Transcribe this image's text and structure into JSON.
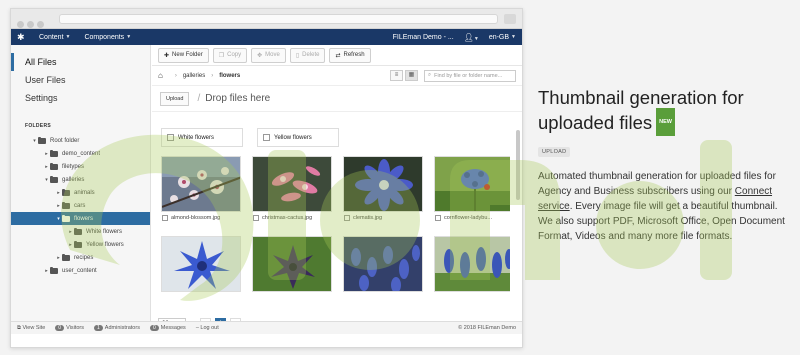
{
  "topbar": {
    "menu_content": "Content",
    "menu_components": "Components",
    "site_name": "FILEman Demo - ...",
    "language": "en-GB"
  },
  "sidebar": {
    "nav": [
      "All Files",
      "User Files",
      "Settings"
    ],
    "folders_label": "FOLDERS",
    "tree": [
      {
        "label": "Root folder",
        "depth": 0,
        "arrow": "▾"
      },
      {
        "label": "demo_content",
        "depth": 1,
        "arrow": "▸"
      },
      {
        "label": "filetypes",
        "depth": 1,
        "arrow": "▸"
      },
      {
        "label": "galleries",
        "depth": 1,
        "arrow": "▾"
      },
      {
        "label": "animals",
        "depth": 2,
        "arrow": "▸"
      },
      {
        "label": "cars",
        "depth": 2,
        "arrow": "▸"
      },
      {
        "label": "flowers",
        "depth": 2,
        "arrow": "▾",
        "selected": true
      },
      {
        "label": "White flowers",
        "depth": 3,
        "arrow": "▸"
      },
      {
        "label": "Yellow flowers",
        "depth": 3,
        "arrow": "▸"
      },
      {
        "label": "recipes",
        "depth": 2,
        "arrow": "▸"
      },
      {
        "label": "user_content",
        "depth": 1,
        "arrow": "▸"
      }
    ]
  },
  "toolbar": {
    "new_folder": "New Folder",
    "copy": "Copy",
    "move": "Move",
    "delete": "Delete",
    "refresh": "Refresh"
  },
  "path": {
    "galleries": "galleries",
    "flowers": "flowers",
    "search_placeholder": "Find by file or folder name..."
  },
  "dropzone": {
    "upload_btn": "Upload",
    "text": "Drop files here"
  },
  "folders": [
    "White flowers",
    "Yellow flowers"
  ],
  "files": [
    {
      "name": "almond-blossom.jpg",
      "icon": "flower-photo"
    },
    {
      "name": "christmas-cactus.jpg",
      "icon": "flower-photo"
    },
    {
      "name": "clematis.jpg",
      "icon": "flower-photo"
    },
    {
      "name": "cornflower-ladybu...",
      "icon": "flower-photo"
    }
  ],
  "pager": {
    "page_size": "20",
    "prev": "«",
    "current": "1",
    "next": "»"
  },
  "statusbar": {
    "view_site": "View Site",
    "visitors_count": "0",
    "visitors": "Visitors",
    "admins_count": "1",
    "admins": "Administrators",
    "messages_count": "0",
    "messages": "Messages",
    "logout": "Log out",
    "copyright": "© 2018 FILEman Demo"
  },
  "panel": {
    "title": "Thumbnail generation for uploaded files",
    "new_badge": "NEW",
    "tag": "UPLOAD",
    "text_1": "Automated thumbnail generation for uploaded files for Agency and Business subscribers using our ",
    "link": "Connect service",
    "text_2": ". Every image file will get a beautiful thumbnail. We also support PDF, Microsoft Office, Open Document Format, Videos and many more file formats."
  },
  "colors": {
    "topbar": "#1a3867",
    "accent": "#2d6ca2",
    "new_badge": "#5a9e3a"
  }
}
